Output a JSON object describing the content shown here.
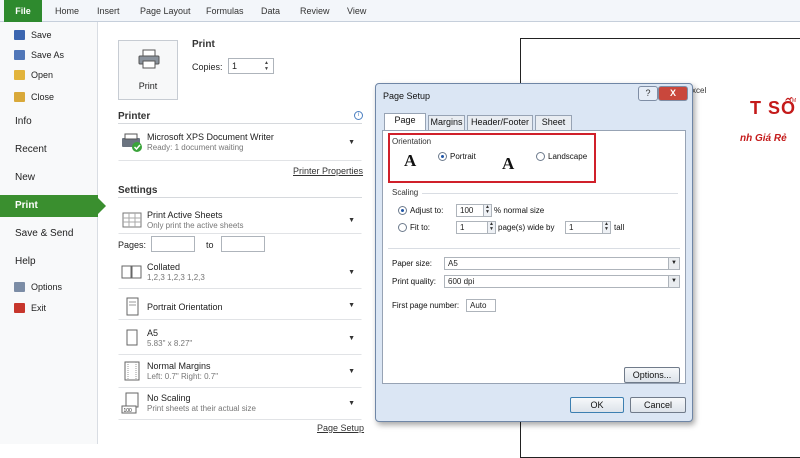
{
  "ribbon": {
    "tabs": [
      "File",
      "Home",
      "Insert",
      "Page Layout",
      "Formulas",
      "Data",
      "Review",
      "View"
    ]
  },
  "nav": {
    "save": "Save",
    "save_as": "Save As",
    "open": "Open",
    "close": "Close",
    "info": "Info",
    "recent": "Recent",
    "new": "New",
    "print": "Print",
    "save_send": "Save & Send",
    "help": "Help",
    "options": "Options",
    "exit": "Exit"
  },
  "print": {
    "heading": "Print",
    "button_label": "Print",
    "copies_label": "Copies:",
    "copies_value": "1",
    "printer_heading": "Printer",
    "printer_name": "Microsoft XPS Document Writer",
    "printer_status": "Ready: 1 document waiting",
    "printer_properties": "Printer Properties",
    "settings_heading": "Settings",
    "active_sheets": "Print Active Sheets",
    "active_sheets_sub": "Only print the active sheets",
    "pages_label": "Pages:",
    "to_label": "to",
    "collated": "Collated",
    "collated_sub": "1,2,3   1,2,3   1,2,3",
    "orientation": "Portrait Orientation",
    "paper": "A5",
    "paper_sub": "5.83\" x 8.27\"",
    "margins": "Normal Margins",
    "margins_sub": "Left:  0.7\"    Right:  0.7\"",
    "scaling": "No Scaling",
    "scaling_sub": "Print sheets at their actual size",
    "scaling_icon_text": "100",
    "page_setup_link": "Page Setup"
  },
  "preview": {
    "excel_text": "xcel",
    "logo_text": "T SỐ",
    "logo_tm": "TM",
    "tagline": "nh Giá Rẻ"
  },
  "dialog": {
    "title": "Page Setup",
    "help_btn": "?",
    "close_btn": "X",
    "tabs": [
      "Page",
      "Margins",
      "Header/Footer",
      "Sheet"
    ],
    "orientation_label": "Orientation",
    "portrait": "Portrait",
    "landscape": "Landscape",
    "scaling_label": "Scaling",
    "adjust_to": "Adjust to:",
    "adjust_value": "100",
    "adjust_suffix": "% normal size",
    "fit_to": "Fit to:",
    "fit_wide_value": "1",
    "fit_wide_suffix": "page(s) wide by",
    "fit_tall_value": "1",
    "fit_tall_suffix": "tall",
    "paper_size_label": "Paper size:",
    "paper_size_value": "A5",
    "print_quality_label": "Print quality:",
    "print_quality_value": "600 dpi",
    "first_page_label": "First page number:",
    "first_page_value": "Auto",
    "options_btn": "Options...",
    "ok_btn": "OK",
    "cancel_btn": "Cancel",
    "glyph_a": "A"
  },
  "colors": {
    "file_tab": "#2e8a2e",
    "print_active": "#3a8f2f",
    "highlight_box": "#d0202a",
    "logo": "#c41a1a"
  }
}
